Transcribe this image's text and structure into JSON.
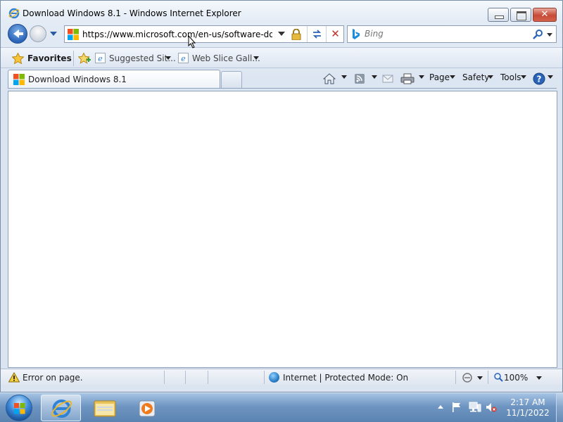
{
  "window": {
    "title": "Download Windows 8.1 - Windows Internet Explorer",
    "close_glyph": "✕"
  },
  "nav": {
    "address_url": "https://www.microsoft.com/en-us/software-downl",
    "search_placeholder": "Bing"
  },
  "favorites_bar": {
    "label": "Favorites",
    "links": [
      "Suggested Sit...",
      "Web Slice Gall..."
    ]
  },
  "tabs": {
    "active_title": "Download Windows 8.1"
  },
  "command_bar": {
    "page_label": "Page",
    "safety_label": "Safety",
    "tools_label": "Tools"
  },
  "status_bar": {
    "message": "Error on page.",
    "zone": "Internet | Protected Mode: On",
    "zoom": "100%"
  },
  "taskbar": {
    "time": "2:17 AM",
    "date": "11/1/2022"
  },
  "icons": {
    "back": "back-arrow-icon",
    "forward": "forward-arrow-icon",
    "lock": "lock-icon",
    "refresh": "refresh-icon",
    "stop": "stop-icon",
    "search": "search-icon",
    "home": "home-icon",
    "feeds": "rss-icon",
    "mail": "mail-icon",
    "print": "printer-icon",
    "help": "help-icon"
  },
  "colors": {
    "accent": "#2a64b9",
    "stop_red": "#c4332b",
    "close_red": "#c74a37"
  }
}
